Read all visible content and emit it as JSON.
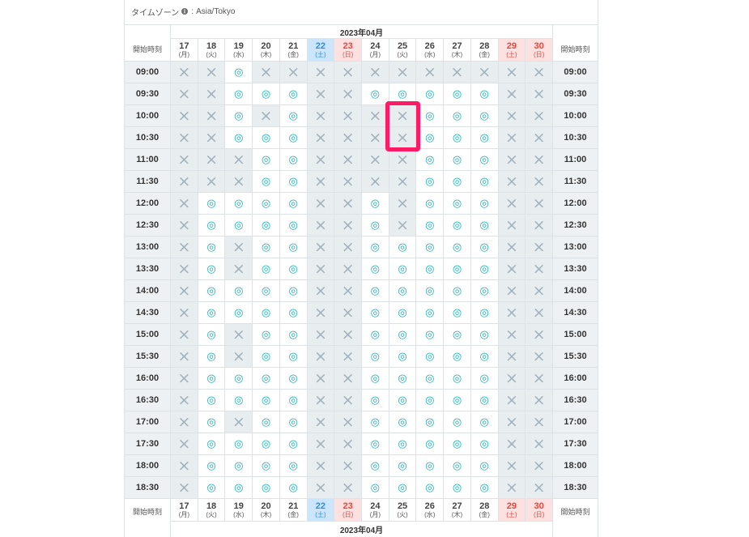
{
  "timezone": {
    "label": "タイムゾーン",
    "icon": "info-icon",
    "separator": ":",
    "value": "Asia/Tokyo"
  },
  "calendar": {
    "month_label": "2023年04月",
    "start_time_label": "開始時刻",
    "days": [
      {
        "day": "17",
        "weekday": "(月)"
      },
      {
        "day": "18",
        "weekday": "(火)"
      },
      {
        "day": "19",
        "weekday": "(水)"
      },
      {
        "day": "20",
        "weekday": "(木)"
      },
      {
        "day": "21",
        "weekday": "(金)"
      },
      {
        "day": "22",
        "weekday": "(土)",
        "text_color": "#2b8fe3",
        "bg_color": "#cce5fa"
      },
      {
        "day": "23",
        "weekday": "(日)",
        "text_color": "#e8453c",
        "bg_color": "#fde1e0"
      },
      {
        "day": "24",
        "weekday": "(月)"
      },
      {
        "day": "25",
        "weekday": "(火)"
      },
      {
        "day": "26",
        "weekday": "(水)"
      },
      {
        "day": "27",
        "weekday": "(木)"
      },
      {
        "day": "28",
        "weekday": "(金)"
      },
      {
        "day": "29",
        "weekday": "(土)",
        "text_color": "#e8453c",
        "bg_color": "#fde1e0"
      },
      {
        "day": "30",
        "weekday": "(日)",
        "text_color": "#e8453c",
        "bg_color": "#fde1e0"
      }
    ],
    "slots": [
      {
        "time": "09:00",
        "cells": [
          "×",
          "×",
          "◎",
          "×",
          "×",
          "×",
          "×",
          "×",
          "×",
          "×",
          "×",
          "×",
          "×",
          "×"
        ]
      },
      {
        "time": "09:30",
        "cells": [
          "×",
          "×",
          "◎",
          "◎",
          "◎",
          "×",
          "×",
          "◎",
          "◎",
          "◎",
          "◎",
          "◎",
          "×",
          "×"
        ]
      },
      {
        "time": "10:00",
        "cells": [
          "×",
          "×",
          "◎",
          "×",
          "◎",
          "×",
          "×",
          "×",
          "×",
          "◎",
          "◎",
          "◎",
          "×",
          "×"
        ]
      },
      {
        "time": "10:30",
        "cells": [
          "×",
          "×",
          "◎",
          "◎",
          "◎",
          "×",
          "×",
          "×",
          "×",
          "◎",
          "◎",
          "◎",
          "×",
          "×"
        ]
      },
      {
        "time": "11:00",
        "cells": [
          "×",
          "×",
          "×",
          "◎",
          "◎",
          "×",
          "×",
          "×",
          "×",
          "◎",
          "◎",
          "◎",
          "×",
          "×"
        ]
      },
      {
        "time": "11:30",
        "cells": [
          "×",
          "×",
          "×",
          "◎",
          "◎",
          "×",
          "×",
          "×",
          "×",
          "◎",
          "◎",
          "◎",
          "×",
          "×"
        ]
      },
      {
        "time": "12:00",
        "cells": [
          "×",
          "◎",
          "◎",
          "◎",
          "◎",
          "×",
          "×",
          "◎",
          "×",
          "◎",
          "◎",
          "◎",
          "×",
          "×"
        ]
      },
      {
        "time": "12:30",
        "cells": [
          "×",
          "◎",
          "◎",
          "◎",
          "◎",
          "×",
          "×",
          "◎",
          "×",
          "◎",
          "◎",
          "◎",
          "×",
          "×"
        ]
      },
      {
        "time": "13:00",
        "cells": [
          "×",
          "◎",
          "×",
          "◎",
          "◎",
          "×",
          "×",
          "◎",
          "◎",
          "◎",
          "◎",
          "◎",
          "×",
          "×"
        ]
      },
      {
        "time": "13:30",
        "cells": [
          "×",
          "◎",
          "×",
          "◎",
          "◎",
          "×",
          "×",
          "◎",
          "◎",
          "◎",
          "◎",
          "◎",
          "×",
          "×"
        ]
      },
      {
        "time": "14:00",
        "cells": [
          "×",
          "◎",
          "◎",
          "◎",
          "◎",
          "×",
          "×",
          "◎",
          "◎",
          "◎",
          "◎",
          "◎",
          "×",
          "×"
        ]
      },
      {
        "time": "14:30",
        "cells": [
          "×",
          "◎",
          "◎",
          "◎",
          "◎",
          "×",
          "×",
          "◎",
          "◎",
          "◎",
          "◎",
          "◎",
          "×",
          "×"
        ]
      },
      {
        "time": "15:00",
        "cells": [
          "×",
          "◎",
          "×",
          "◎",
          "◎",
          "×",
          "×",
          "◎",
          "◎",
          "◎",
          "◎",
          "◎",
          "×",
          "×"
        ]
      },
      {
        "time": "15:30",
        "cells": [
          "×",
          "◎",
          "×",
          "◎",
          "◎",
          "×",
          "×",
          "◎",
          "◎",
          "◎",
          "◎",
          "◎",
          "×",
          "×"
        ]
      },
      {
        "time": "16:00",
        "cells": [
          "×",
          "◎",
          "◎",
          "◎",
          "◎",
          "×",
          "×",
          "◎",
          "◎",
          "◎",
          "◎",
          "◎",
          "×",
          "×"
        ]
      },
      {
        "time": "16:30",
        "cells": [
          "×",
          "◎",
          "◎",
          "◎",
          "◎",
          "×",
          "×",
          "◎",
          "◎",
          "◎",
          "◎",
          "◎",
          "×",
          "×"
        ]
      },
      {
        "time": "17:00",
        "cells": [
          "×",
          "◎",
          "×",
          "◎",
          "◎",
          "×",
          "×",
          "◎",
          "◎",
          "◎",
          "◎",
          "◎",
          "×",
          "×"
        ]
      },
      {
        "time": "17:30",
        "cells": [
          "×",
          "◎",
          "◎",
          "◎",
          "◎",
          "×",
          "×",
          "◎",
          "◎",
          "◎",
          "◎",
          "◎",
          "×",
          "×"
        ]
      },
      {
        "time": "18:00",
        "cells": [
          "×",
          "◎",
          "◎",
          "◎",
          "◎",
          "×",
          "×",
          "◎",
          "◎",
          "◎",
          "◎",
          "◎",
          "×",
          "×"
        ]
      },
      {
        "time": "18:30",
        "cells": [
          "×",
          "◎",
          "◎",
          "◎",
          "◎",
          "×",
          "×",
          "◎",
          "◎",
          "◎",
          "◎",
          "◎",
          "×",
          "×"
        ]
      }
    ]
  },
  "colors": {
    "available": "#1baeb6",
    "unavailable": "#a2b1bb",
    "unavailable_bg": "#e8edf0",
    "time_bg": "#eef1f3",
    "grid_border": "#dce2e6",
    "panel_border": "#e0e0e0",
    "highlight": "#ff1a66"
  }
}
